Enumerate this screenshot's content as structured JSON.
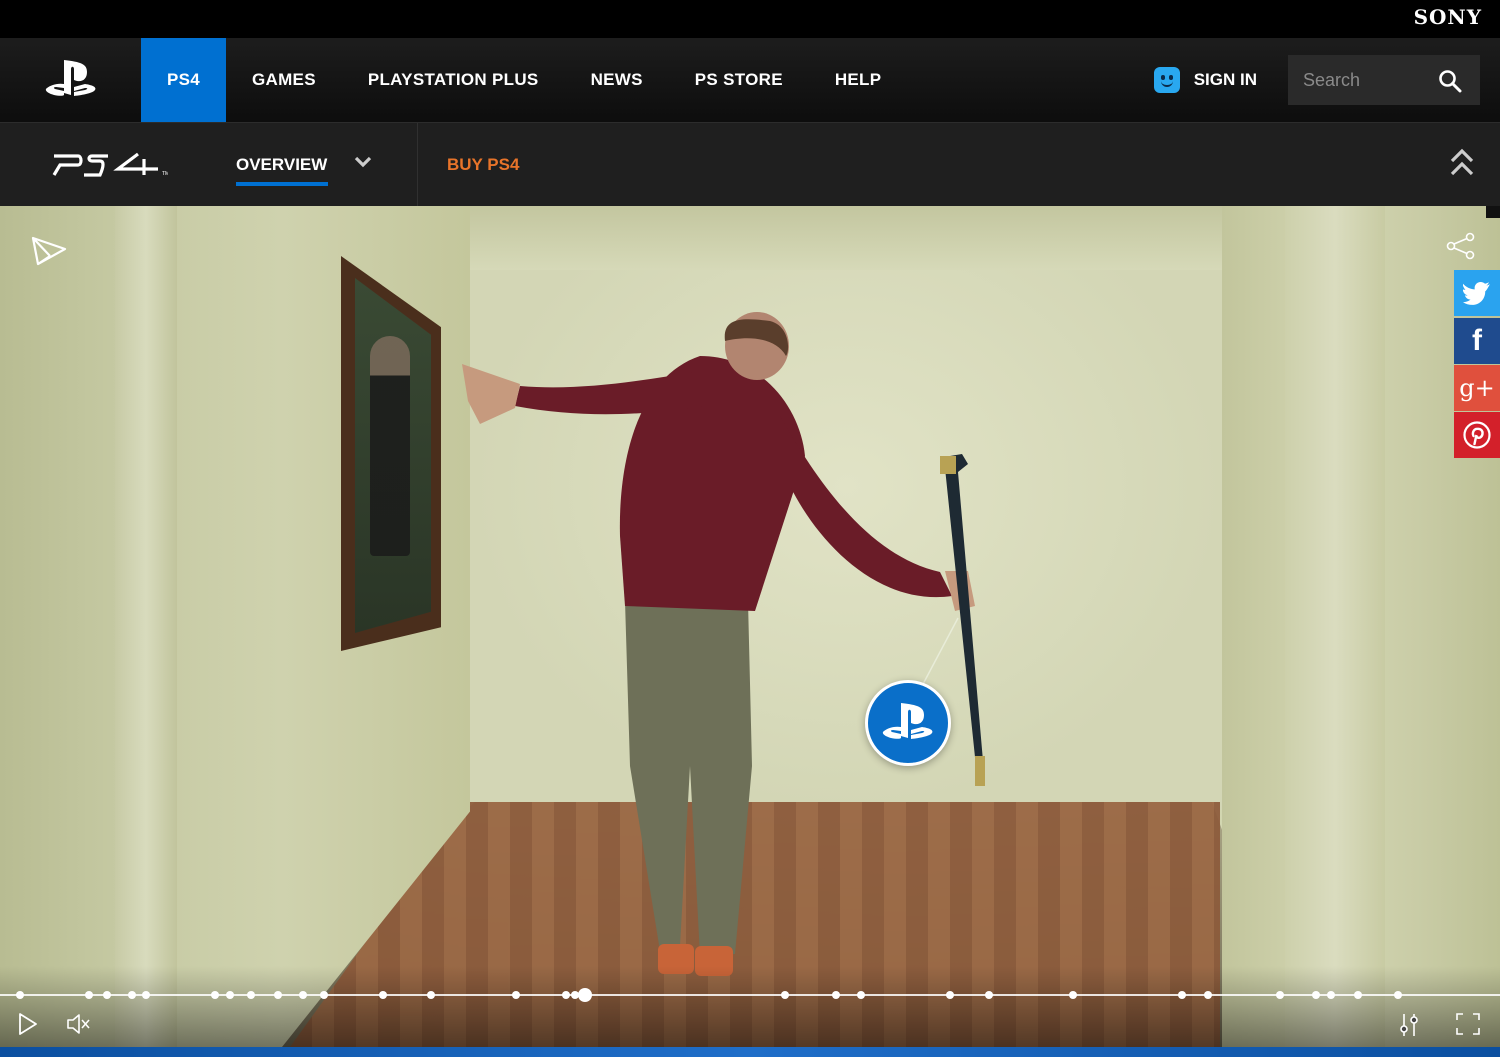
{
  "brand": {
    "sony": "SONY"
  },
  "nav": {
    "items": [
      {
        "label": "PS4",
        "active": true
      },
      {
        "label": "GAMES"
      },
      {
        "label": "PLAYSTATION PLUS"
      },
      {
        "label": "NEWS"
      },
      {
        "label": "PS STORE"
      },
      {
        "label": "HELP"
      }
    ],
    "sign_in": "SIGN IN",
    "search_placeholder": "Search"
  },
  "subnav": {
    "overview": "OVERVIEW",
    "buy": "BUY PS4"
  },
  "colors": {
    "accent_blue": "#0070d1",
    "buy_orange": "#e8742a",
    "twitter": "#2aa3ef",
    "facebook": "#1f4b8e",
    "gplus": "#e0503d",
    "pinterest": "#d3202a"
  },
  "icons": {
    "home": "playstation-logo-icon",
    "user": "smiley-icon",
    "search": "search-icon",
    "collapse": "double-chevron-up-icon",
    "share": "share-icon",
    "play": "play-icon",
    "mute": "mute-icon",
    "settings": "sliders-icon",
    "fullscreen": "fullscreen-icon"
  },
  "video": {
    "progress": 0.39,
    "markers": [
      0.013,
      0.059,
      0.071,
      0.088,
      0.097,
      0.143,
      0.153,
      0.167,
      0.185,
      0.202,
      0.216,
      0.255,
      0.287,
      0.344,
      0.377,
      0.383,
      0.523,
      0.557,
      0.574,
      0.633,
      0.659,
      0.715,
      0.788,
      0.805,
      0.853,
      0.877,
      0.887,
      0.905,
      0.932
    ]
  },
  "social": {
    "twitter": "t",
    "facebook": "f",
    "gplus": "g+",
    "pinterest": "p"
  }
}
